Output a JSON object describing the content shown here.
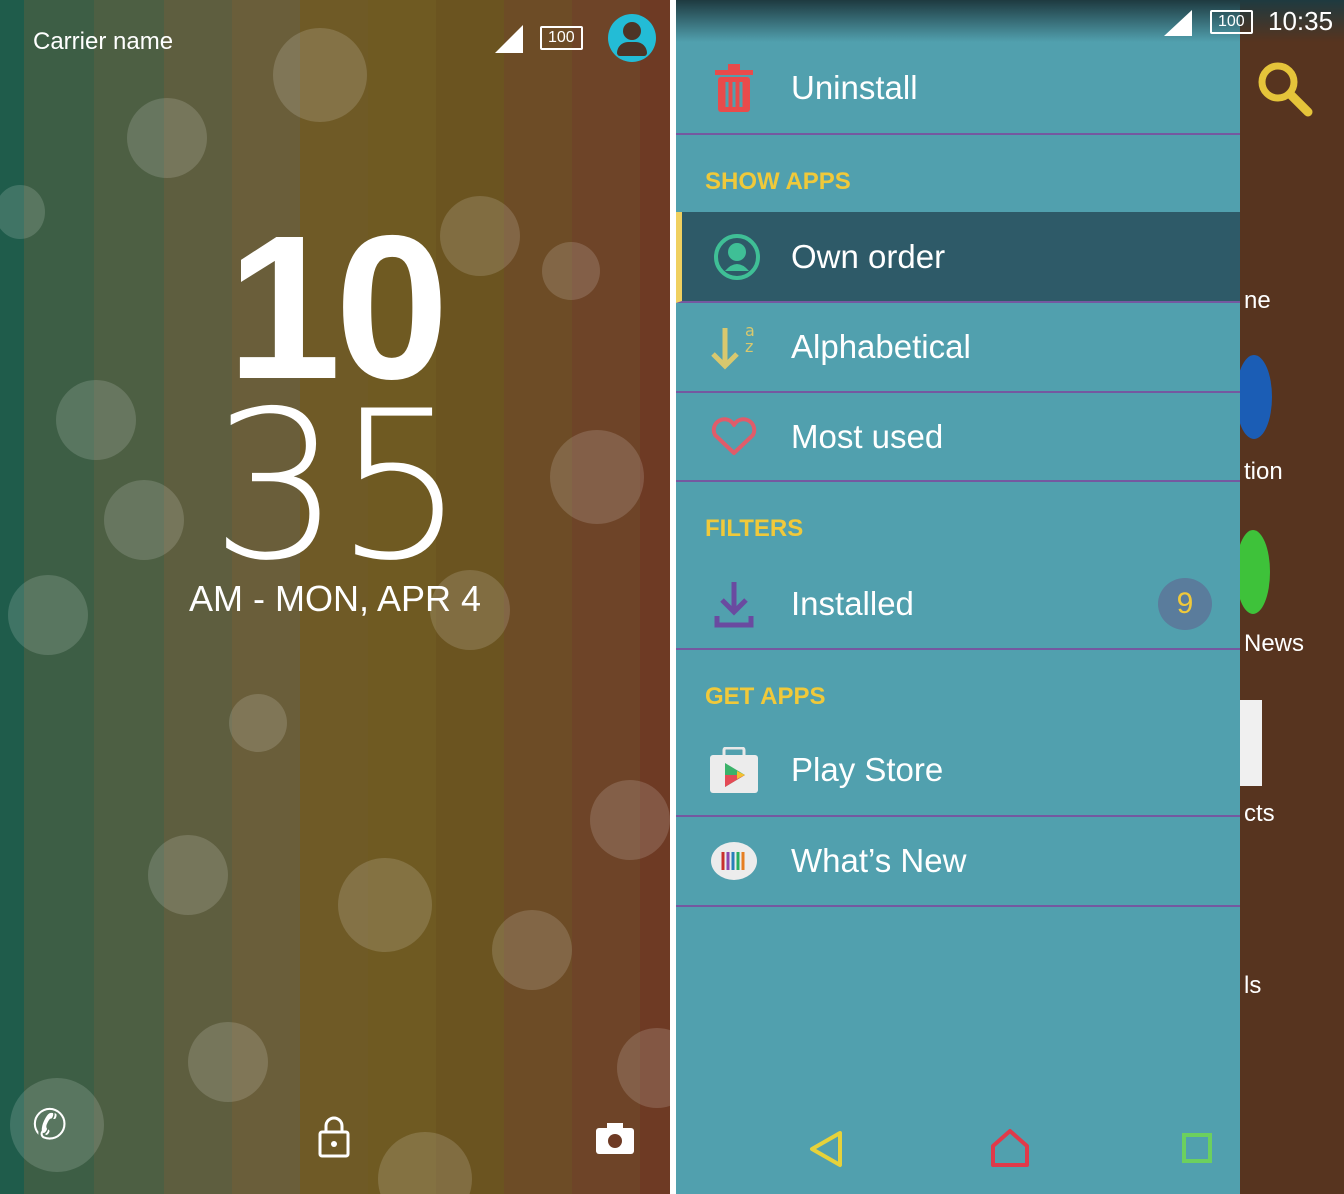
{
  "lockscreen": {
    "carrier": "Carrier name",
    "battery": "100",
    "hour": "10",
    "minute": "35",
    "date": "AM - MON, APR 4",
    "icons": [
      "signal-icon",
      "battery-icon",
      "user-avatar-icon",
      "phone-icon",
      "unlock-icon",
      "camera-icon"
    ]
  },
  "drawer": {
    "status": {
      "battery": "100",
      "time": "10:35"
    },
    "uninstall": "Uninstall",
    "show_apps_header": "SHOW APPS",
    "show_apps": [
      {
        "label": "Own order",
        "selected": true
      },
      {
        "label": "Alphabetical"
      },
      {
        "label": "Most used"
      }
    ],
    "filters_header": "FILTERS",
    "installed": {
      "label": "Installed",
      "count": "9"
    },
    "get_apps_header": "GET APPS",
    "get_apps": [
      {
        "label": "Play Store"
      },
      {
        "label": "What’s New"
      }
    ],
    "background_labels": [
      "ne",
      "tion",
      "News",
      "cts",
      "ls"
    ],
    "colors": {
      "drawer": "#51a0ae",
      "selected": "#2e5a68",
      "accent": "#f0c93a",
      "divider": "#7558a0"
    }
  }
}
